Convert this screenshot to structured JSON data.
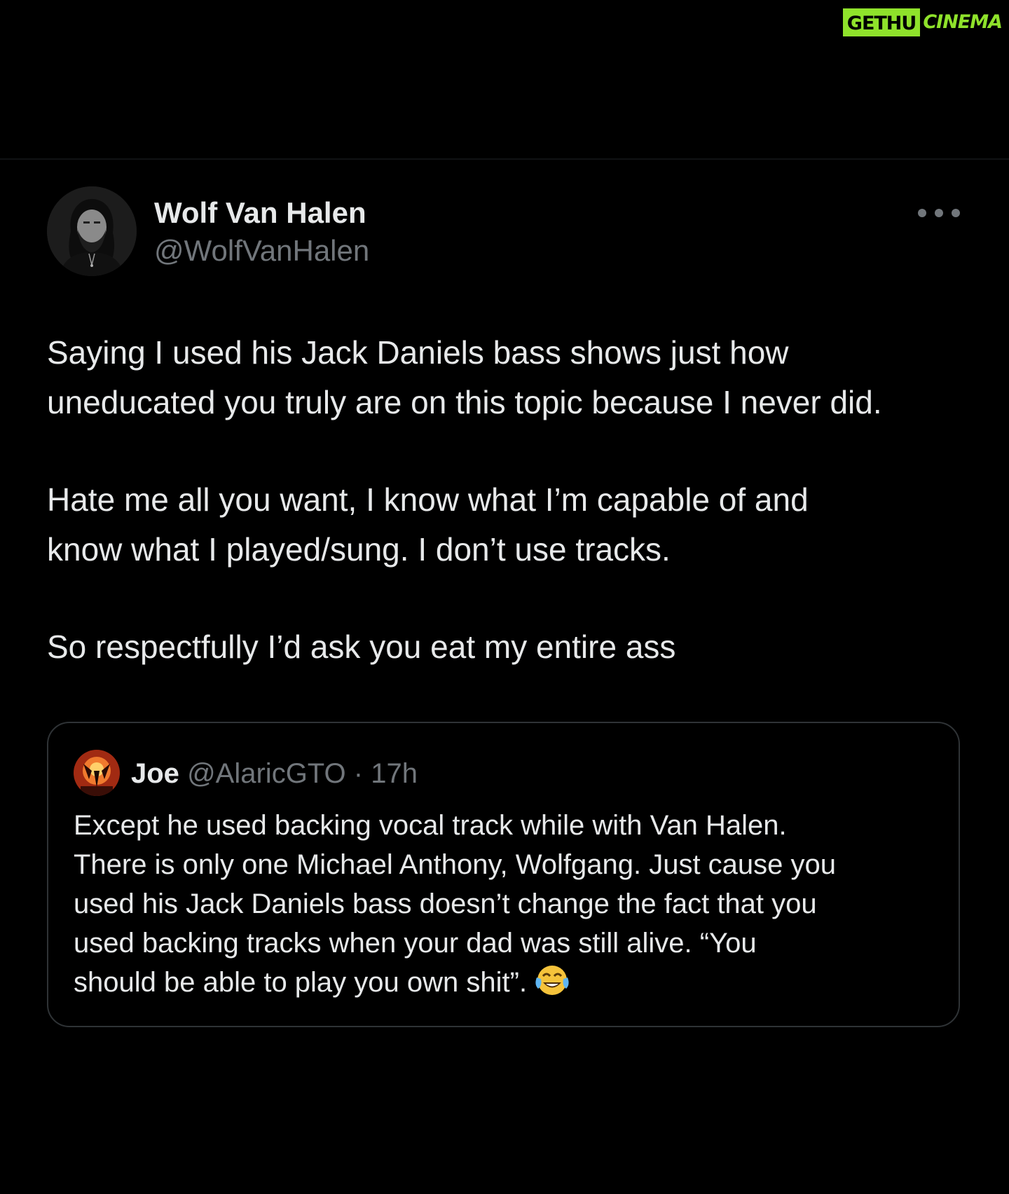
{
  "watermark": {
    "part1": "GETHU",
    "part2": "CINEMA",
    "accent_color": "#8fe22b"
  },
  "tweet": {
    "author": {
      "name": "Wolf Van Halen",
      "handle": "@WolfVanHalen"
    },
    "more_icon": "more-horizontal-icon",
    "paragraphs": [
      {
        "lines": [
          "Saying I used his Jack Daniels bass shows just how",
          "uneducated you truly are on this topic because I never did."
        ]
      },
      {
        "lines": [
          "Hate me all you want, I know what I’m capable of and",
          "know what I played/sung. I don’t use tracks."
        ]
      },
      {
        "lines": [
          "So respectfully I’d ask you eat my entire ass"
        ]
      }
    ]
  },
  "quoted_tweet": {
    "author": {
      "name": "Joe",
      "handle": "@AlaricGTO"
    },
    "separator": "·",
    "time": "17h",
    "lines": [
      "Except he used backing vocal track while with Van Halen.",
      "There is only one Michael Anthony, Wolfgang. Just cause you",
      "used his Jack Daniels bass doesn’t change the fact that you",
      "used backing tracks when your dad was still alive.  “You",
      "should be able to play you own shit”."
    ],
    "emoji_icon": "tears-of-joy-emoji"
  },
  "colors": {
    "background": "#000000",
    "text_primary": "#e7e9ea",
    "text_secondary": "#71767b",
    "border": "#2f3336"
  }
}
